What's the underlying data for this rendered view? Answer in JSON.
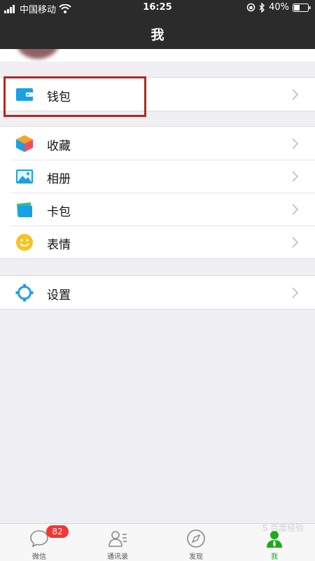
{
  "status": {
    "carrier": "中国移动",
    "time": "16:25",
    "battery": "40%"
  },
  "nav": {
    "title": "我"
  },
  "menu": {
    "wallet": {
      "label": "钱包",
      "icon": "wallet-icon",
      "color": "#1aa0e6"
    },
    "group2": [
      {
        "label": "收藏",
        "icon": "favorites-cube-icon"
      },
      {
        "label": "相册",
        "icon": "album-photo-icon"
      },
      {
        "label": "卡包",
        "icon": "card-package-icon"
      },
      {
        "label": "表情",
        "icon": "emoji-smiley-icon"
      }
    ],
    "settings": {
      "label": "设置",
      "icon": "settings-gear-icon"
    }
  },
  "tabs": [
    {
      "label": "微信",
      "icon": "chat-bubble-icon",
      "badge": "82"
    },
    {
      "label": "通讯录",
      "icon": "contacts-icon"
    },
    {
      "label": "发现",
      "icon": "compass-icon"
    },
    {
      "label": "我",
      "icon": "me-person-icon",
      "active": true
    }
  ],
  "watermark": "S 百度经验",
  "colors": {
    "accent_green": "#1aad19",
    "badge_red": "#f43530",
    "highlight_red": "#b02a23",
    "header_dark": "#2b2b2b"
  }
}
